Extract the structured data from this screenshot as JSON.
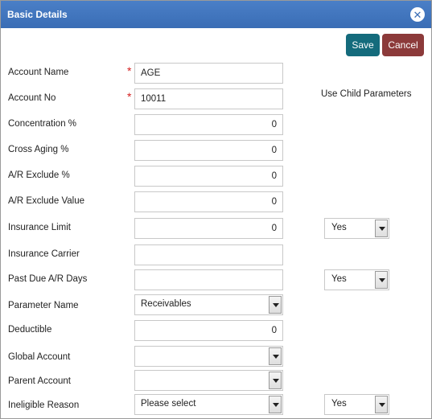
{
  "dialog": {
    "title": "Basic Details",
    "save_label": "Save",
    "cancel_label": "Cancel",
    "child_params_label": "Use Child Parameters"
  },
  "fields": {
    "account_name": {
      "label": "Account Name",
      "value": "AGE"
    },
    "account_no": {
      "label": "Account No",
      "value": "10011"
    },
    "concentration": {
      "label": "Concentration %",
      "value": "0"
    },
    "cross_aging": {
      "label": "Cross Aging %",
      "value": "0"
    },
    "ar_exclude_pct": {
      "label": "A/R Exclude %",
      "value": "0"
    },
    "ar_exclude_value": {
      "label": "A/R Exclude Value",
      "value": "0"
    },
    "insurance_limit": {
      "label": "Insurance Limit",
      "value": "0",
      "child": "Yes"
    },
    "insurance_carrier": {
      "label": "Insurance Carrier",
      "value": ""
    },
    "past_due_days": {
      "label": "Past Due A/R Days",
      "value": "",
      "child": "Yes"
    },
    "parameter_name": {
      "label": "Parameter Name",
      "value": "Receivables"
    },
    "deductible": {
      "label": "Deductible",
      "value": "0"
    },
    "global_account": {
      "label": "Global Account",
      "value": ""
    },
    "parent_account": {
      "label": "Parent Account",
      "value": ""
    },
    "ineligible_reason": {
      "label": "Ineligible Reason",
      "value": "Please select",
      "child": "Yes"
    }
  },
  "required_marker": "*",
  "close_glyph": "✕"
}
